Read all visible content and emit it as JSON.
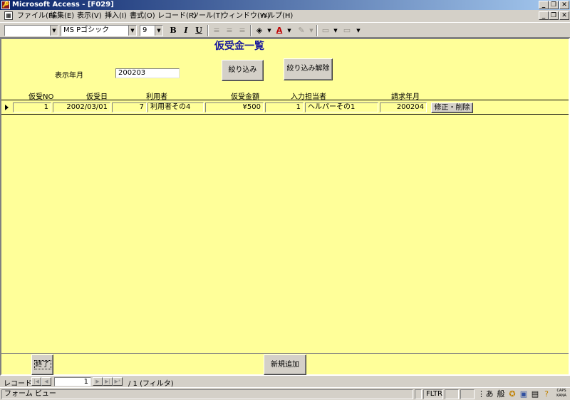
{
  "window": {
    "title": "Microsoft Access - [F029]",
    "app_icon": "access-key-icon",
    "controls": [
      "_",
      "❐",
      "✕"
    ]
  },
  "menubar": {
    "doc_icon": "form-icon",
    "items": [
      "ファイル(F)",
      "編集(E)",
      "表示(V)",
      "挿入(I)",
      "書式(O)",
      "レコード(R)",
      "ツール(T)",
      "ウィンドウ(W)",
      "ヘルプ(H)"
    ]
  },
  "toolbar": {
    "object_combo": "",
    "font_combo": "MS Pゴシック",
    "size_combo": "9",
    "bold": "B",
    "italic": "I",
    "underline": "U",
    "align_left": "≡",
    "align_center": "≡",
    "align_right": "≡",
    "fill_color": "◈",
    "font_color": "A",
    "line_color": "✎",
    "line_width": "▭",
    "special_effect": "▭"
  },
  "form": {
    "title": "仮受金一覧",
    "filter_label": "表示年月",
    "filter_value": "200203",
    "filter_button": "絞り込み",
    "clear_filter_button": "絞り込み解除",
    "columns": [
      "仮受NO",
      "仮受日",
      "利用者",
      "仮受金額",
      "入力担当者",
      "請求年月"
    ],
    "rows": [
      {
        "no": "1",
        "date": "2002/03/01",
        "user_id": "7",
        "user_name": "利用者その4",
        "amount": "¥500",
        "staff_id": "1",
        "staff_name": "ヘルパーその1",
        "billing_month": "200204",
        "action": "修正・削除"
      }
    ],
    "exit_button": "終了",
    "add_button": "新規追加"
  },
  "record_nav": {
    "label": "レコード:",
    "current": "1",
    "total": "/ 1 (フィルタ)"
  },
  "statusbar": {
    "mode": "フォーム ビュー",
    "filter": "FLTR",
    "ime_mode": "あ",
    "ime_conv": "般",
    "caps": "CAPS",
    "kana": "KANA"
  },
  "colors": {
    "form_background": "#ffff99",
    "title_color": "#1a1a9c",
    "titlebar_start": "#0a246a",
    "titlebar_end": "#a6caf0"
  }
}
